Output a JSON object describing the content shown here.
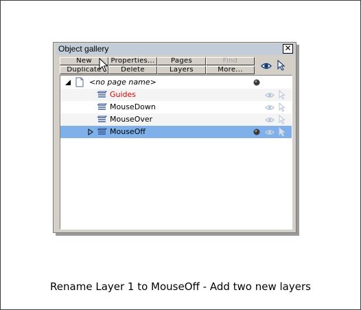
{
  "panel": {
    "title": "Object gallery",
    "close_glyph": "✕"
  },
  "toolbar": {
    "row1": [
      {
        "label": "New",
        "enabled": true
      },
      {
        "label": "Properties...",
        "enabled": true
      },
      {
        "label": "Pages",
        "enabled": true
      },
      {
        "label": "Find",
        "enabled": false
      }
    ],
    "row2": [
      {
        "label": "Duplicate",
        "enabled": true
      },
      {
        "label": "Delete",
        "enabled": true
      },
      {
        "label": "Layers",
        "enabled": true
      },
      {
        "label": "More...",
        "enabled": true
      }
    ],
    "icons": [
      "eye-icon",
      "arrow-cursor-icon"
    ]
  },
  "tree": {
    "page": {
      "label": "<no page name>",
      "expanded": true
    },
    "layers": [
      {
        "label": "Guides",
        "color": "#e00000",
        "selected": false
      },
      {
        "label": "MouseDown",
        "color": "#000000",
        "selected": false
      },
      {
        "label": "MouseOver",
        "color": "#000000",
        "selected": false
      },
      {
        "label": "MouseOff",
        "color": "#000000",
        "selected": true
      }
    ]
  },
  "colors": {
    "panel_bg": "#d4d0c8",
    "titlebar_bg": "#c3ccd9",
    "selection": "#7fb0ea",
    "guides_text": "#e00000"
  },
  "caption": "Rename Layer 1 to MouseOff - Add two new layers"
}
